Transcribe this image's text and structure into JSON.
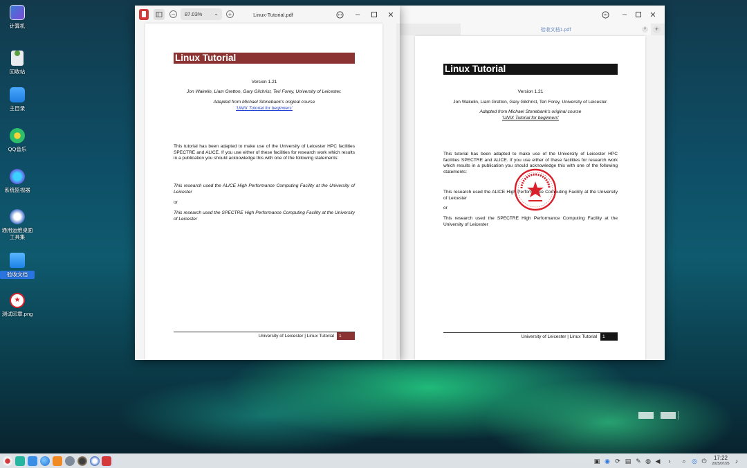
{
  "desktop": {
    "icons": [
      {
        "label": "计算机",
        "icon": "computer-icon"
      },
      {
        "label": "回收站",
        "icon": "trash-icon"
      },
      {
        "label": "主目录",
        "icon": "home-folder-icon"
      },
      {
        "label": "QQ音乐",
        "icon": "qq-music-icon"
      },
      {
        "label": "系统监视器",
        "icon": "system-monitor-icon"
      },
      {
        "label": "通用运维桌面工具集",
        "icon": "ops-toolkit-icon"
      },
      {
        "label": "验收文档",
        "icon": "folder-icon"
      },
      {
        "label": "测试印章.png",
        "icon": "stamp-image-icon"
      }
    ]
  },
  "left_window": {
    "zoom": "87.03%",
    "title": "Linux-Tutorial.pdf",
    "accent": "#8b3232",
    "page": {
      "heading": "Linux Tutorial",
      "version": "Version 1.21",
      "authors": "Jon Wakelin, Liam Gretton, Gary Gilchrist, Teri Forey, University of Leicester.",
      "adapted": "Adapted from Michael Stonebank's original course",
      "course_link": "'UNIX Tutorial for beginners'",
      "intro": "This tutorial has been adapted to make use of the University of Leicester HPC facilities SPECTRE and ALICE. If you use either of these facilities for research work which results in a publication you should acknowledge this with one of the following statements:",
      "statement1": "This research used the ALICE High Performance Computing Facility at the University of Leicester",
      "or": "or",
      "statement2": "This research used the SPECTRE High Performance Computing Facility at the University of Leicester",
      "footer": "University of Leicester | Linux Tutorial",
      "page_number": "1"
    }
  },
  "right_window": {
    "tab_title": "验收文档1.pdf",
    "accent": "#151515",
    "stamp_color": "#d9202a",
    "page": {
      "heading": "Linux Tutorial",
      "version": "Version 1.21",
      "authors": "Jon Wakelin, Liam Gretton, Gary Gilchrist, Teri Forey, University of Leicester.",
      "adapted": "Adapted from Michael Stonebank's original course",
      "course_link": "'UNIX Tutorial for beginners'",
      "intro": "This tutorial has been adapted to make use of the University of Leicester HPC facilities SPECTRE and ALICE. If you use either of these facilities for research work which results in a publication you should acknowledge this with one of the following statements:",
      "statement1": "This research used the ALICE High Performance Computing Facility at the University of Leicester",
      "or": "or",
      "statement2": "This research used the SPECTRE High Performance Computing Facility at the University of Leicester",
      "footer": "University of Leicester | Linux Tutorial",
      "page_number": "1"
    }
  },
  "taskbar": {
    "time": "17:22",
    "date": "2025/07/26"
  }
}
